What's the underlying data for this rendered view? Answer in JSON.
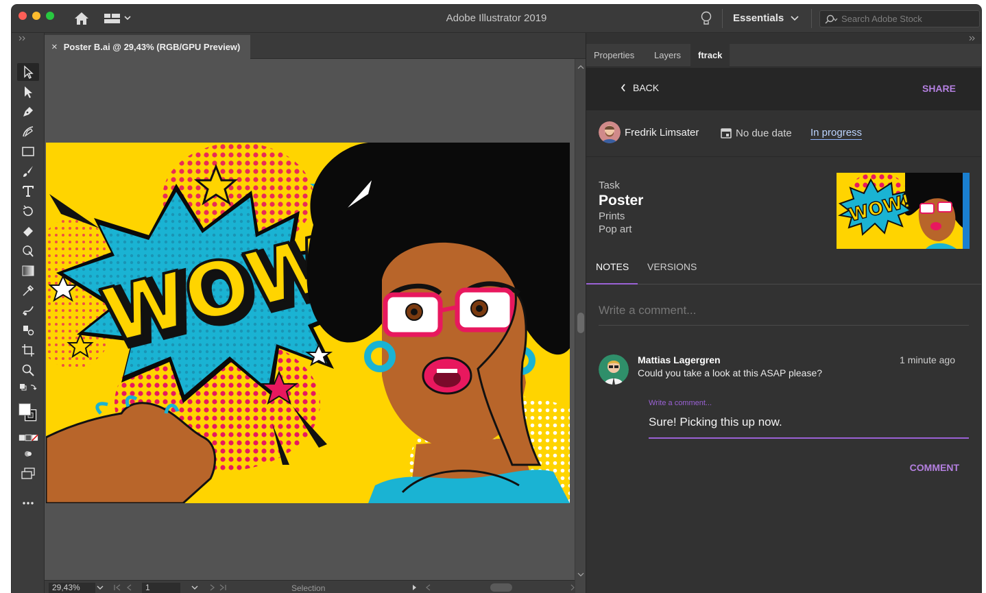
{
  "window": {
    "title": "Adobe Illustrator 2019",
    "workspace": "Essentials",
    "search_placeholder": "Search Adobe Stock"
  },
  "document": {
    "tab_label": "Poster B.ai @ 29,43% (RGB/GPU Preview)",
    "close_glyph": "×"
  },
  "statusbar": {
    "zoom": "29,43%",
    "page": "1",
    "tool_name": "Selection"
  },
  "artwork": {
    "wow_text": "WOW!"
  },
  "panel": {
    "tabs": [
      "Properties",
      "Layers",
      "ftrack"
    ],
    "active_tab": "ftrack",
    "back_label": "BACK",
    "share_label": "SHARE",
    "assignee": "Fredrik Limsater",
    "due_date": "No due date",
    "status": "In progress",
    "task": {
      "label": "Task",
      "name": "Poster",
      "parent": "Prints",
      "project": "Pop art"
    },
    "notes_tabs": [
      "NOTES",
      "VERSIONS"
    ],
    "comment_placeholder": "Write a comment...",
    "note": {
      "author": "Mattias Lagergren",
      "text": "Could you take a look at this ASAP please?",
      "time": "1 minute ago"
    },
    "reply": {
      "label": "Write a comment...",
      "value": "Sure! Picking this up now."
    },
    "comment_button": "COMMENT"
  },
  "colors": {
    "accent": "#9b62d6",
    "status_link": "#bcd4ff",
    "canvas": "#535353",
    "art_yellow": "#ffd400",
    "art_cyan": "#1ab3d3",
    "art_pink": "#e8185e"
  }
}
